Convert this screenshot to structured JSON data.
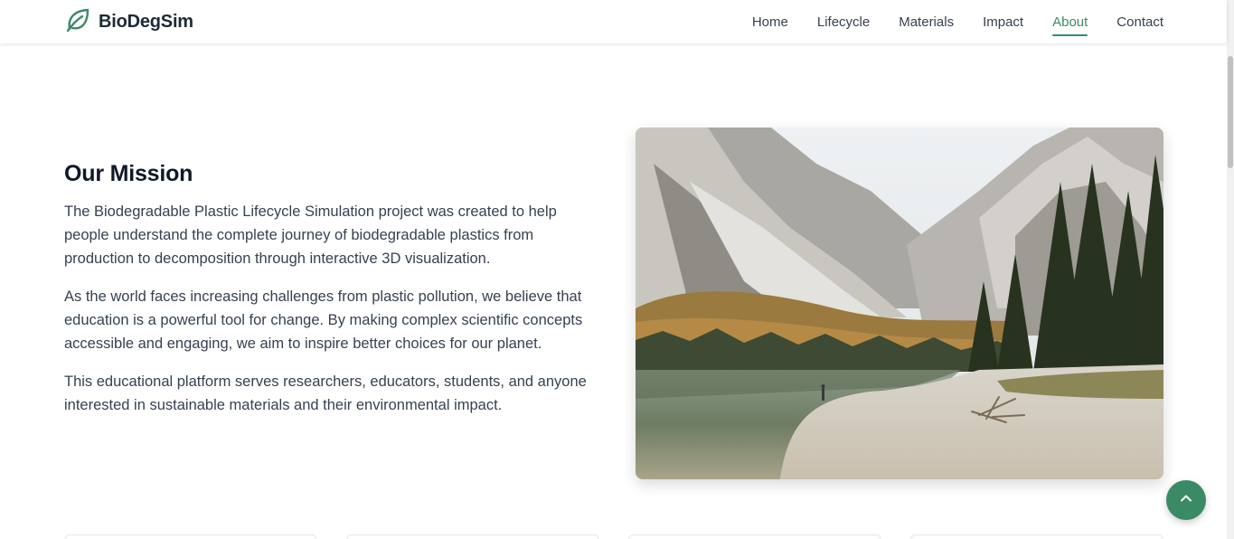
{
  "brand": {
    "name": "BioDegSim",
    "logo_icon": "leaf-icon",
    "color": "#3b8a66"
  },
  "nav": {
    "items": [
      {
        "label": "Home",
        "active": false
      },
      {
        "label": "Lifecycle",
        "active": false
      },
      {
        "label": "Materials",
        "active": false
      },
      {
        "label": "Impact",
        "active": false
      },
      {
        "label": "About",
        "active": true
      },
      {
        "label": "Contact",
        "active": false
      }
    ]
  },
  "mission": {
    "title": "Our Mission",
    "paragraphs": [
      "The Biodegradable Plastic Lifecycle Simulation project was created to help people understand the complete journey of biodegradable plastics from production to decomposition through interactive 3D visualization.",
      "As the world faces increasing challenges from plastic pollution, we believe that education is a powerful tool for change. By making complex scientific concepts accessible and engaging, we aim to inspire better choices for our planet.",
      "This educational platform serves researchers, educators, students, and anyone interested in sustainable materials and their environmental impact."
    ]
  },
  "scroll_top": {
    "icon": "chevron-up-icon"
  }
}
